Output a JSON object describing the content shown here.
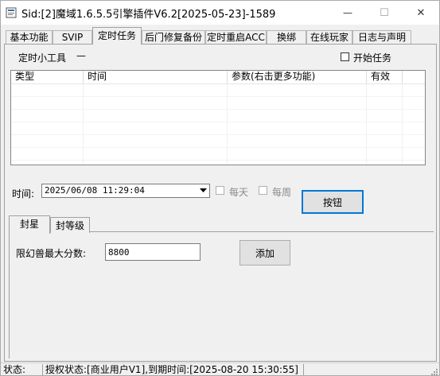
{
  "window": {
    "title": "Sid:[2]魔域1.6.5.5引擎插件V6.2[2025-05-23]-1589",
    "minimize_label": "—",
    "maximize_label": "☐",
    "close_label": "✕"
  },
  "main_tabs": [
    {
      "label": "基本功能"
    },
    {
      "label": "SVIP"
    },
    {
      "label": "定时任务"
    },
    {
      "label": "后门修复备份"
    },
    {
      "label": "定时重启ACC"
    },
    {
      "label": "换绑"
    },
    {
      "label": "在线玩家"
    },
    {
      "label": "日志与声明"
    }
  ],
  "timer_tool": {
    "label": "定时小工具",
    "dash": "—",
    "start_task_label": "开始任务"
  },
  "task_list": {
    "columns": [
      "类型",
      "时间",
      "参数(右击更多功能)",
      "有效"
    ],
    "rows": []
  },
  "time_row": {
    "label": "时间:",
    "value": "2025/06/08 11:29:04",
    "every_day_label": "每天",
    "every_week_label": "每周",
    "button_label": "按钮"
  },
  "sub_tabs": [
    {
      "label": "封星"
    },
    {
      "label": "封等级"
    }
  ],
  "seal_star": {
    "max_score_label": "限幻兽最大分数:",
    "max_score_value": "8800",
    "add_button_label": "添加"
  },
  "status_bar": {
    "status_label": "状态:",
    "license_text": "授权状态:[商业用户V1],到期时间:[2025-08-20 15:30:55]"
  }
}
